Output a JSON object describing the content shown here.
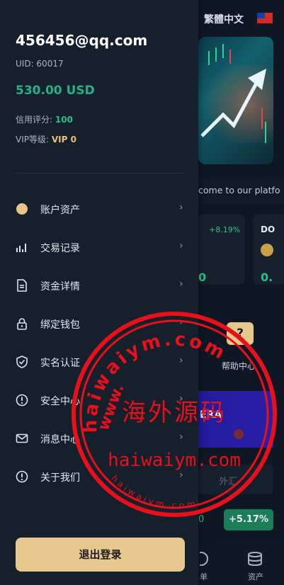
{
  "background": {
    "language": "繁體中文",
    "marquee": "come to our platfo",
    "coin_pct": "+8.19%",
    "coin_code": "DO",
    "coin_value_a": "0",
    "coin_value_b": "0.",
    "help_icon": "?",
    "help_label": "帮助中心",
    "banner2_text": "ERA",
    "box_text": "外汇",
    "row_value": "0",
    "row_pct": "+5.17%",
    "tab_orders": "单",
    "tab_assets": "资产"
  },
  "drawer": {
    "email": "456456@qq.com",
    "uid": "UID: 60017",
    "balance": "530.00 USD",
    "credit_label": "信用评分: ",
    "credit_value": "100",
    "vip_label": "VIP等级: ",
    "vip_value": "VIP 0",
    "menu": [
      {
        "label": "账户资产",
        "icon": "coin-icon"
      },
      {
        "label": "交易记录",
        "icon": "bar-chart-icon"
      },
      {
        "label": "资金详情",
        "icon": "document-icon"
      },
      {
        "label": "绑定钱包",
        "icon": "lock-icon"
      },
      {
        "label": "实名认证",
        "icon": "shield-check-icon"
      },
      {
        "label": "安全中心",
        "icon": "alert-circle-icon"
      },
      {
        "label": "消息中心",
        "icon": "mail-icon"
      },
      {
        "label": "关于我们",
        "icon": "info-circle-icon"
      }
    ],
    "logout_label": "退出登录",
    "chevron": "›"
  },
  "watermark": {
    "arc_top": "haiwaiym.com",
    "arc_left": "www.",
    "center_cn": "海外源码",
    "center_en": "haiwaiym.com",
    "arc_bottom": "haiwaiym.com"
  },
  "colors": {
    "accent_green": "#22b386",
    "gold": "#e7c88e",
    "watermark_red": "#e8101a"
  }
}
